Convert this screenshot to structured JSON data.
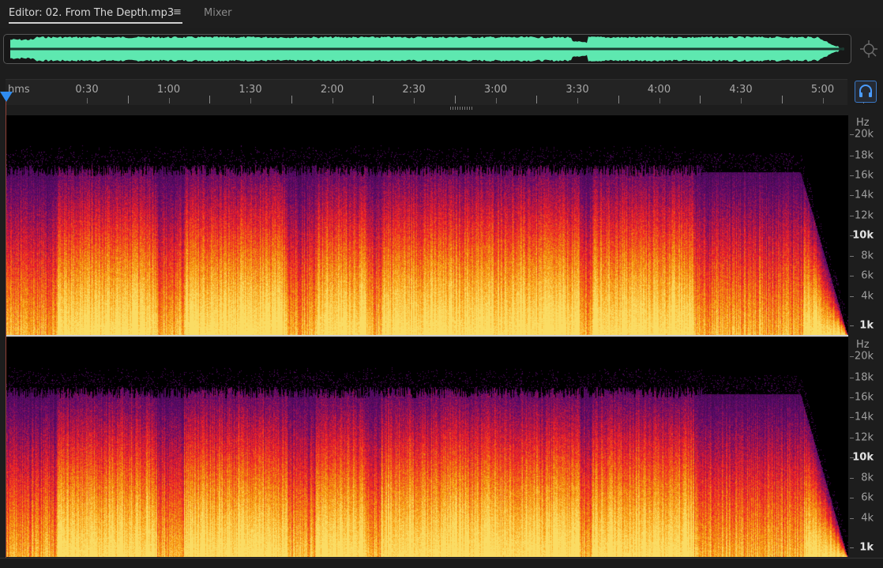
{
  "tabs": {
    "editor_label": "Editor: 02. From The Depth.mp3",
    "menu_glyph": "≡",
    "mixer_label": "Mixer"
  },
  "ruler": {
    "unit": "hms",
    "labels": [
      "0:30",
      "1:00",
      "1:30",
      "2:00",
      "2:30",
      "3:00",
      "3:30",
      "4:00",
      "4:30",
      "5:00"
    ]
  },
  "frequency_axis": {
    "unit": "Hz",
    "labels": [
      "20k",
      "18k",
      "16k",
      "14k",
      "12k",
      "10k",
      "8k",
      "6k",
      "4k",
      "1k"
    ],
    "bold_labels": [
      "10k",
      "1k"
    ]
  },
  "colors": {
    "waveform": "#5ee8b0",
    "playhead": "#2f8cf0",
    "accent": "#3a78c6"
  },
  "icons": {
    "zoom": "zoom-navigator-icon",
    "monitor": "headphones-icon",
    "menu": "hamburger-menu-icon"
  }
}
